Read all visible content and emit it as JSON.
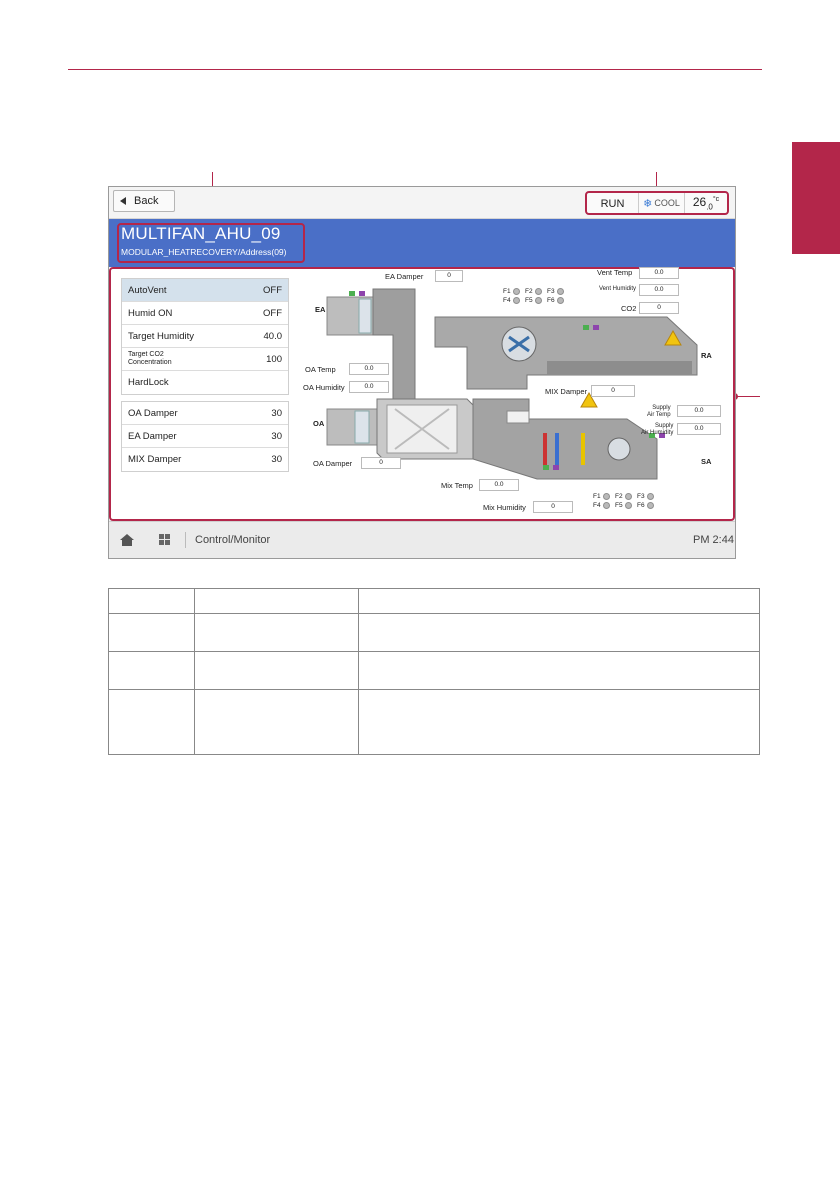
{
  "screen": {
    "back_label": "Back",
    "status": {
      "run": "RUN",
      "mode": "COOL",
      "temp": "26",
      "temp_decimal": ".0",
      "temp_unit": "°c"
    },
    "unit": {
      "name": "MULTIFAN_AHU_09",
      "subtitle": "MODULAR_HEATRECOVERY/Address(09)"
    },
    "settings": [
      {
        "label": "AutoVent",
        "value": "OFF"
      },
      {
        "label": "Humid ON",
        "value": "OFF"
      },
      {
        "label": "Target Humidity",
        "value": "40.0"
      },
      {
        "label": "Target CO2\nConcentration",
        "value": "100"
      },
      {
        "label": "HardLock",
        "value": ""
      }
    ],
    "dampers": [
      {
        "label": "OA Damper",
        "value": "30"
      },
      {
        "label": "EA Damper",
        "value": "30"
      },
      {
        "label": "MIX Damper",
        "value": "30"
      }
    ],
    "diagram": {
      "ea_damper": {
        "label": "EA Damper",
        "value": "0"
      },
      "vent_temp": {
        "label": "Vent Temp",
        "value": "0.0"
      },
      "vent_humidity": {
        "label": "Vent Humidity",
        "value": "0.0"
      },
      "co2": {
        "label": "CO2",
        "value": "0"
      },
      "oa_temp": {
        "label": "OA Temp",
        "value": "0.0"
      },
      "oa_humidity": {
        "label": "OA Humidity",
        "value": "0.0"
      },
      "mix_damper": {
        "label": "MIX Damper",
        "value": "0"
      },
      "supply_air_temp": {
        "label1": "Supply",
        "label2": "Air Temp",
        "value": "0.0"
      },
      "supply_air_humidity": {
        "label1": "Supply",
        "label2": "Air Humidity",
        "value": "0.0"
      },
      "oa_damper": {
        "label": "OA Damper",
        "value": "0"
      },
      "mix_temp": {
        "label": "Mix Temp",
        "value": "0.0"
      },
      "mix_humidity": {
        "label": "Mix Humidity",
        "value": "0"
      },
      "zones": {
        "ea": "EA",
        "oa": "OA",
        "ra": "RA",
        "sa": "SA"
      },
      "fans_top": [
        "F1",
        "F2",
        "F3",
        "F4",
        "F5",
        "F6"
      ],
      "fans_bottom": [
        "F1",
        "F2",
        "F3",
        "F4",
        "F5",
        "F6"
      ]
    },
    "bottom": {
      "breadcrumb": "Control/Monitor",
      "clock": "PM 2:44"
    }
  },
  "colors": {
    "accent": "#b3264a",
    "header_blue": "#4a6fc7"
  }
}
